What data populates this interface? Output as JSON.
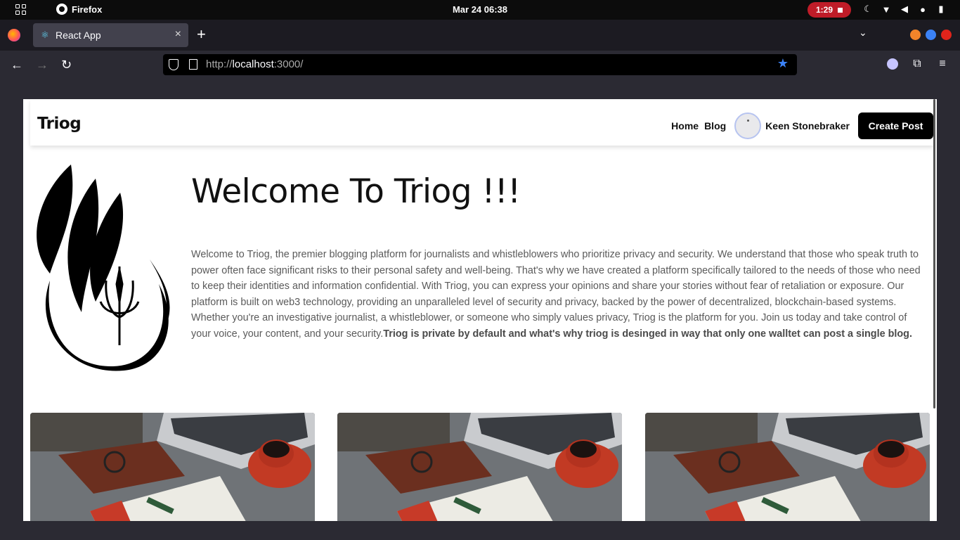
{
  "system": {
    "app_name": "Firefox",
    "clock": "Mar 24  06:38",
    "recording_time": "1:29"
  },
  "browser": {
    "tab_title": "React App",
    "url_scheme": "http://",
    "url_host": "localhost",
    "url_rest": ":3000/"
  },
  "site": {
    "brand": "Triog",
    "nav": {
      "home": "Home",
      "blog": "Blog",
      "username": "Keen Stonebraker",
      "create_post": "Create Post"
    },
    "hero": {
      "title": "Welcome To Triog !!!",
      "body": "Welcome to Triog, the premier blogging platform for journalists and whistleblowers who prioritize privacy and security. We understand that those who speak truth to power often face significant risks to their personal safety and well-being. That's why we have created a platform specifically tailored to the needs of those who need to keep their identities and information confidential. With Triog, you can express your opinions and share your stories without fear of retaliation or exposure. Our platform is built on web3 technology, providing an unparalleled level of security and privacy, backed by the power of decentralized, blockchain-based systems. Whether you're an investigative journalist, a whistleblower, or someone who simply values privacy, Triog is the platform for you. Join us today and take control of your voice, your content, and your security.",
      "body_bold": "Triog is private by default and what's why triog is desinged in way that only one walltet can post a single blog."
    },
    "cards": [
      {
        "image": "desk-laptop-coffee-notebook"
      },
      {
        "image": "desk-laptop-coffee-notebook"
      },
      {
        "image": "desk-laptop-coffee-notebook"
      }
    ]
  },
  "colors": {
    "accent_blue": "#3b82f6",
    "record_red": "#c01c28",
    "button_black": "#000000"
  }
}
